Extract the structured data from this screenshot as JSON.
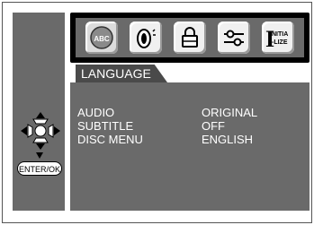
{
  "top_icons": [
    {
      "name": "language-icon",
      "glyph_text": "ABC",
      "selected": true
    },
    {
      "name": "speaker-icon"
    },
    {
      "name": "lock-icon"
    },
    {
      "name": "sliders-icon"
    },
    {
      "name": "initialize-icon",
      "glyph_text_1": "NITIA",
      "glyph_text_2": "-LIZE"
    }
  ],
  "tab": {
    "label": "LANGUAGE"
  },
  "settings": [
    {
      "label": "AUDIO",
      "value": "ORIGINAL"
    },
    {
      "label": "SUBTITLE",
      "value": "OFF"
    },
    {
      "label": "DISC MENU",
      "value": "ENGLISH"
    }
  ],
  "enter_button": {
    "label": "ENTER/OK"
  },
  "colors": {
    "panel": "#6a6a6a",
    "tab": "#4a4a4a",
    "frame": "#000000"
  }
}
